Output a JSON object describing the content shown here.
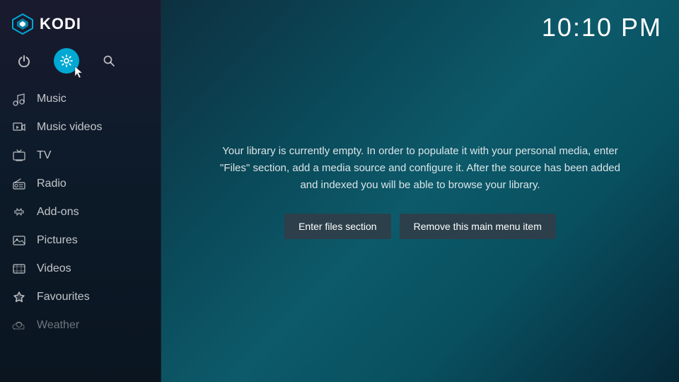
{
  "app": {
    "title": "KODI",
    "clock": "10:10 PM"
  },
  "sidebar": {
    "icons": [
      {
        "name": "power-icon",
        "symbol": "⏻",
        "active": false,
        "label": "Power"
      },
      {
        "name": "settings-icon",
        "symbol": "⚙",
        "active": true,
        "label": "Settings"
      },
      {
        "name": "search-icon",
        "symbol": "🔍",
        "active": false,
        "label": "Search"
      }
    ],
    "menu_items": [
      {
        "id": "music",
        "label": "Music",
        "icon": "🎧"
      },
      {
        "id": "music-videos",
        "label": "Music videos",
        "icon": "🎬"
      },
      {
        "id": "tv",
        "label": "TV",
        "icon": "📺"
      },
      {
        "id": "radio",
        "label": "Radio",
        "icon": "📻"
      },
      {
        "id": "add-ons",
        "label": "Add-ons",
        "icon": "📦"
      },
      {
        "id": "pictures",
        "label": "Pictures",
        "icon": "🖼"
      },
      {
        "id": "videos",
        "label": "Videos",
        "icon": "🎞"
      },
      {
        "id": "favourites",
        "label": "Favourites",
        "icon": "⭐"
      },
      {
        "id": "weather",
        "label": "Weather",
        "icon": "🌥",
        "dimmed": true
      }
    ]
  },
  "main": {
    "library_message": "Your library is currently empty. In order to populate it with your personal media, enter \"Files\" section, add a media source and configure it. After the source has been added and indexed you will be able to browse your library.",
    "enter_files_btn": "Enter files section",
    "remove_menu_btn": "Remove this main menu item"
  }
}
